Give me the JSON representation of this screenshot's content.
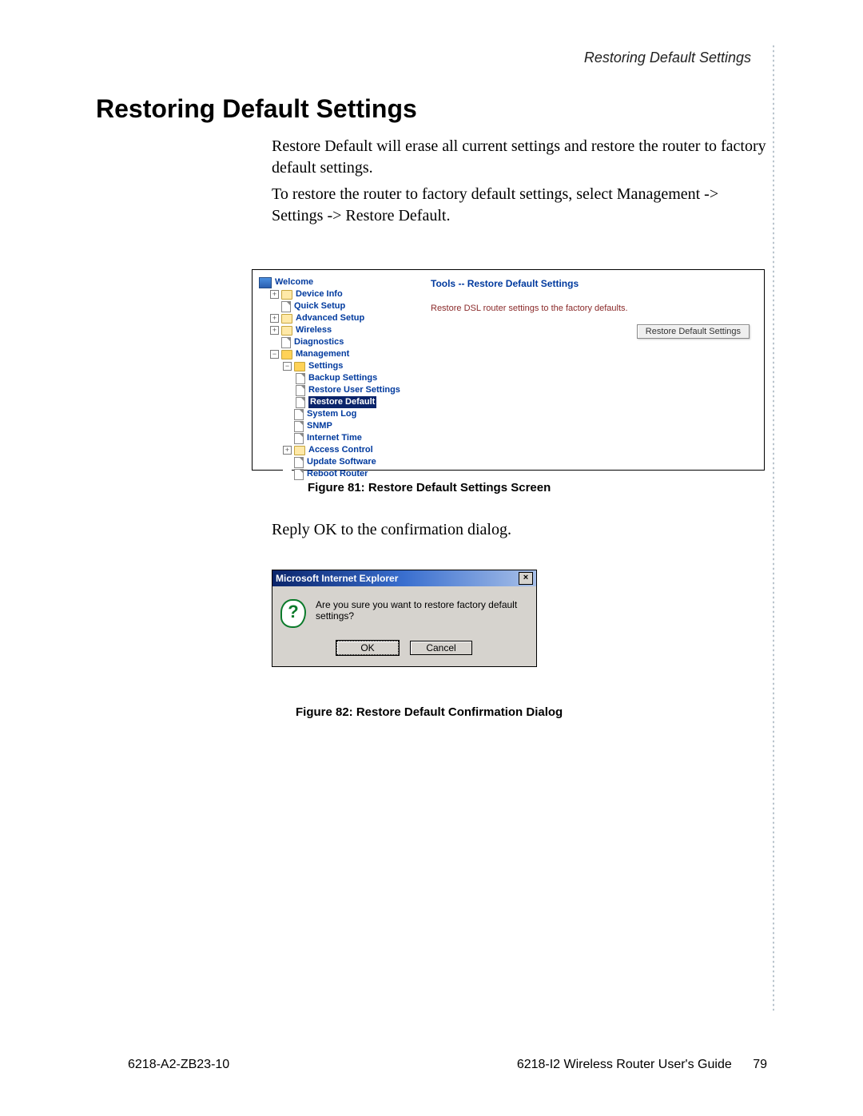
{
  "running_head": "Restoring Default Settings",
  "h1": "Restoring Default Settings",
  "para1": "Restore Default will erase all current settings and restore the router to factory default settings.",
  "para2": "To restore the router to factory default settings, select Management -> Settings -> Restore Default.",
  "para3": "Reply OK to the confirmation dialog.",
  "shot1": {
    "tree": {
      "welcome": "Welcome",
      "device_info": "Device Info",
      "quick_setup": "Quick Setup",
      "advanced_setup": "Advanced Setup",
      "wireless": "Wireless",
      "diagnostics": "Diagnostics",
      "management": "Management",
      "settings": "Settings",
      "backup": "Backup Settings",
      "restore_user": "Restore User Settings",
      "restore_default": "Restore Default",
      "system_log": "System Log",
      "snmp": "SNMP",
      "internet_time": "Internet Time",
      "access_control": "Access Control",
      "update_software": "Update Software",
      "reboot_router": "Reboot Router"
    },
    "content_title": "Tools -- Restore Default Settings",
    "content_desc": "Restore DSL router settings to the factory defaults.",
    "button": "Restore Default Settings"
  },
  "fig1_caption": "Figure 81: Restore Default Settings Screen",
  "dialog": {
    "title": "Microsoft Internet Explorer",
    "message": "Are you sure you want to restore factory default settings?",
    "ok": "OK",
    "cancel": "Cancel"
  },
  "fig2_caption": "Figure 82: Restore Default Confirmation Dialog",
  "footer": {
    "left": "6218-A2-ZB23-10",
    "right": "6218-I2 Wireless Router User's Guide",
    "page": "79"
  }
}
